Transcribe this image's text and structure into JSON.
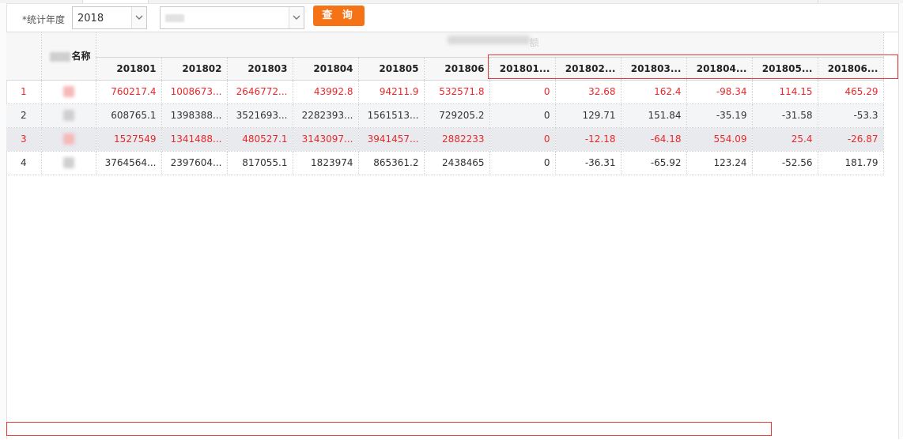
{
  "filters": {
    "year_label": "*统计年度",
    "year_value": "2018",
    "org_value": "",
    "query_button": "查 询"
  },
  "table": {
    "name_header": "名称",
    "group_header_suffix": "额",
    "month_columns": [
      "201801",
      "201802",
      "201803",
      "201804",
      "201805",
      "201806"
    ],
    "rate_columns": [
      "201801...",
      "201802...",
      "201803...",
      "201804...",
      "201805...",
      "201806..."
    ],
    "rows": [
      {
        "index": "1",
        "highlight": "red",
        "values": [
          "760217.4",
          "1008673...",
          "2646772...",
          "43992.8",
          "94211.9",
          "532571.8"
        ],
        "rates": [
          "0",
          "32.68",
          "162.4",
          "-98.34",
          "114.15",
          "465.29"
        ]
      },
      {
        "index": "2",
        "highlight": "",
        "values": [
          "608765.1",
          "1398388...",
          "3521693...",
          "2282393...",
          "1561513...",
          "729205.2"
        ],
        "rates": [
          "0",
          "129.71",
          "151.84",
          "-35.19",
          "-31.58",
          "-53.3"
        ]
      },
      {
        "index": "3",
        "highlight": "red",
        "values": [
          "1527549",
          "1341488...",
          "480527.1",
          "3143097...",
          "3941457...",
          "2882233"
        ],
        "rates": [
          "0",
          "-12.18",
          "-64.18",
          "554.09",
          "25.4",
          "-26.87"
        ]
      },
      {
        "index": "4",
        "highlight": "",
        "values": [
          "3764564...",
          "2397604...",
          "817055.1",
          "1823974",
          "865361.2",
          "2438465"
        ],
        "rates": [
          "0",
          "-36.31",
          "-65.92",
          "123.24",
          "-52.56",
          "181.79"
        ]
      }
    ]
  },
  "colors": {
    "accent_button": "#f57316",
    "highlight_red": "#e8282b",
    "annotation_box": "#e23a3a"
  }
}
